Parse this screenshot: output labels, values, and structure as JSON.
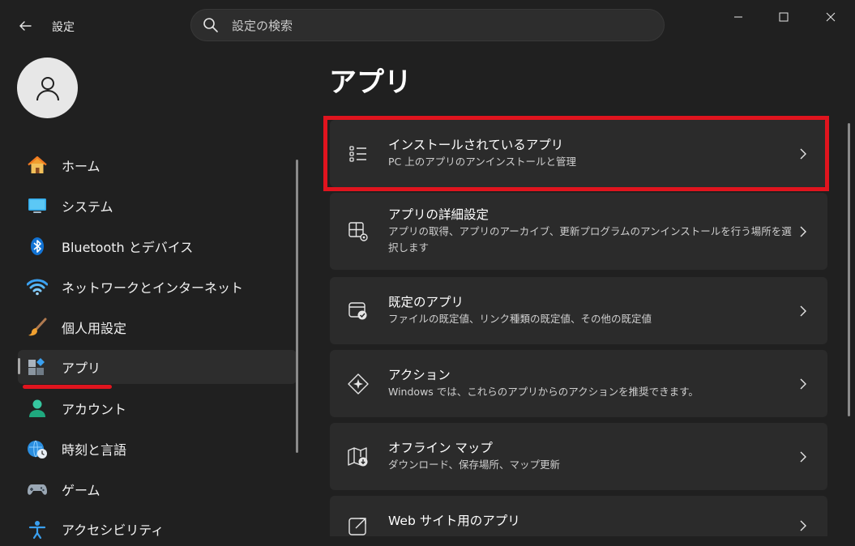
{
  "window": {
    "title": "設定"
  },
  "search": {
    "placeholder": "設定の検索"
  },
  "sidebar": {
    "items": [
      {
        "label": "ホーム",
        "icon": "home-icon"
      },
      {
        "label": "システム",
        "icon": "system-icon"
      },
      {
        "label": "Bluetooth とデバイス",
        "icon": "bluetooth-icon"
      },
      {
        "label": "ネットワークとインターネット",
        "icon": "wifi-icon"
      },
      {
        "label": "個人用設定",
        "icon": "brush-icon"
      },
      {
        "label": "アプリ",
        "icon": "apps-icon",
        "selected": true
      },
      {
        "label": "アカウント",
        "icon": "account-icon"
      },
      {
        "label": "時刻と言語",
        "icon": "clock-globe-icon"
      },
      {
        "label": "ゲーム",
        "icon": "gamepad-icon"
      },
      {
        "label": "アクセシビリティ",
        "icon": "accessibility-icon"
      }
    ]
  },
  "main": {
    "title": "アプリ",
    "cards": [
      {
        "title": "インストールされているアプリ",
        "desc": "PC 上のアプリのアンインストールと管理",
        "icon": "list-icon"
      },
      {
        "title": "アプリの詳細設定",
        "desc": "アプリの取得、アプリのアーカイブ、更新プログラムのアンインストールを行う場所を選択します",
        "icon": "app-settings-icon"
      },
      {
        "title": "既定のアプリ",
        "desc": "ファイルの既定値、リンク種類の既定値、その他の既定値",
        "icon": "default-apps-icon"
      },
      {
        "title": "アクション",
        "desc": "Windows では、これらのアプリからのアクションを推奨できます。",
        "icon": "sparkle-icon"
      },
      {
        "title": "オフライン マップ",
        "desc": "ダウンロード、保存場所、マップ更新",
        "icon": "map-icon"
      },
      {
        "title": "Web サイト用のアプリ",
        "desc": "",
        "icon": "open-external-icon"
      }
    ]
  },
  "colors": {
    "background": "#202020",
    "card": "#2b2b2b",
    "highlight": "#e0141e",
    "accent": "#0078d4"
  }
}
